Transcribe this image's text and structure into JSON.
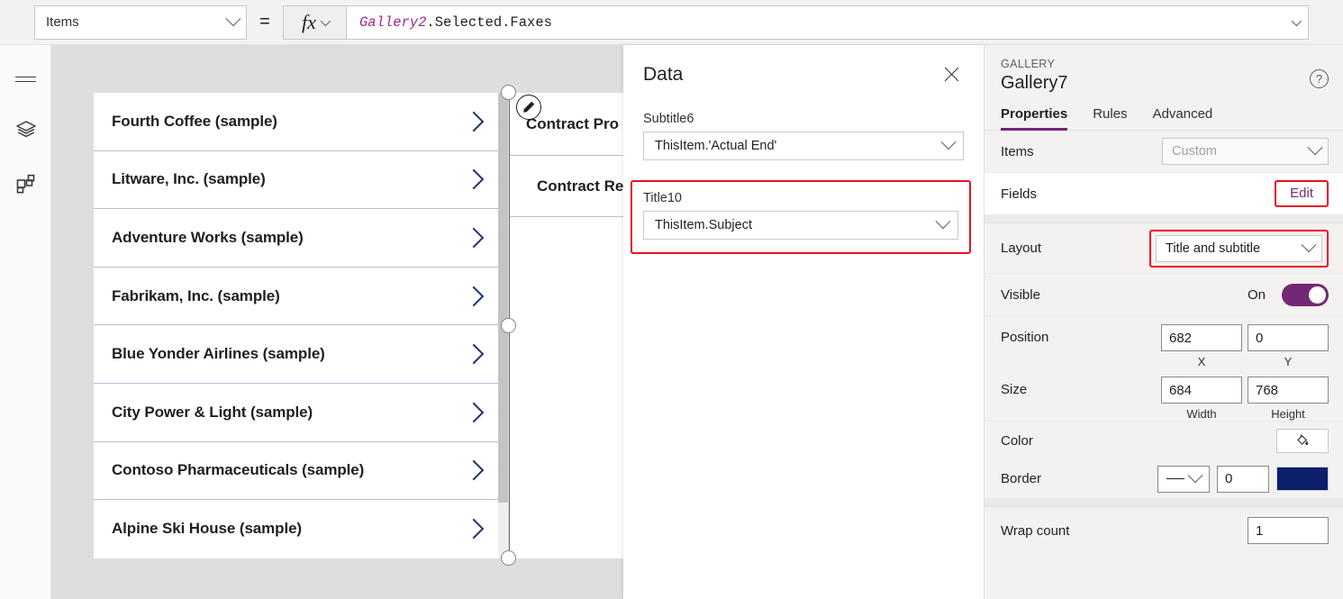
{
  "formula_bar": {
    "property_selector": {
      "value": "Items",
      "icon": "chevron-down-icon"
    },
    "equals": "=",
    "fx_label": "fx",
    "formula_identifier": "Gallery2",
    "formula_rest": ".Selected.Faxes"
  },
  "left_rail": {
    "items": [
      {
        "name": "menu-icon",
        "label": "Menu"
      },
      {
        "name": "screens-layers-icon",
        "label": "Screens"
      },
      {
        "name": "components-grid-icon",
        "label": "Components"
      }
    ]
  },
  "canvas": {
    "gallery_left": {
      "items": [
        {
          "title": "Fourth Coffee (sample)"
        },
        {
          "title": "Litware, Inc. (sample)"
        },
        {
          "title": "Adventure Works (sample)"
        },
        {
          "title": "Fabrikam, Inc. (sample)"
        },
        {
          "title": "Blue Yonder Airlines (sample)"
        },
        {
          "title": "City Power & Light (sample)"
        },
        {
          "title": "Contoso Pharmaceuticals (sample)"
        },
        {
          "title": "Alpine Ski House (sample)"
        }
      ]
    },
    "gallery_right": {
      "items": [
        {
          "title": "Contract Pro"
        },
        {
          "title": "Contract Rev"
        }
      ]
    }
  },
  "data_panel": {
    "title": "Data",
    "close_icon": "close-icon",
    "fields": [
      {
        "label": "Subtitle6",
        "value": "ThisItem.'Actual End'",
        "highlighted": false
      },
      {
        "label": "Title10",
        "value": "ThisItem.Subject",
        "highlighted": true
      }
    ]
  },
  "properties_panel": {
    "kicker": "GALLERY",
    "name": "Gallery7",
    "help_icon": "help-circle-icon",
    "tabs": [
      {
        "label": "Properties",
        "active": true
      },
      {
        "label": "Rules",
        "active": false
      },
      {
        "label": "Advanced",
        "active": false
      }
    ],
    "rows": {
      "items": {
        "label": "Items",
        "value": "Custom"
      },
      "fields": {
        "label": "Fields",
        "action": "Edit"
      },
      "layout": {
        "label": "Layout",
        "value": "Title and subtitle"
      },
      "visible": {
        "label": "Visible",
        "state": "On"
      },
      "position": {
        "label": "Position",
        "x": "682",
        "y": "0",
        "x_caption": "X",
        "y_caption": "Y"
      },
      "size": {
        "label": "Size",
        "width": "684",
        "height": "768",
        "width_caption": "Width",
        "height_caption": "Height"
      },
      "color": {
        "label": "Color",
        "icon": "paint-bucket-icon"
      },
      "border": {
        "label": "Border",
        "style": "solid-line",
        "thickness": "0",
        "swatch": "#0b1f6b"
      },
      "wrap_count": {
        "label": "Wrap count",
        "value": "1"
      }
    }
  },
  "colors": {
    "accent_purple": "#742774",
    "highlight_red": "#e81123",
    "navy": "#0b1f6b",
    "chevron_navy": "#21356d"
  }
}
